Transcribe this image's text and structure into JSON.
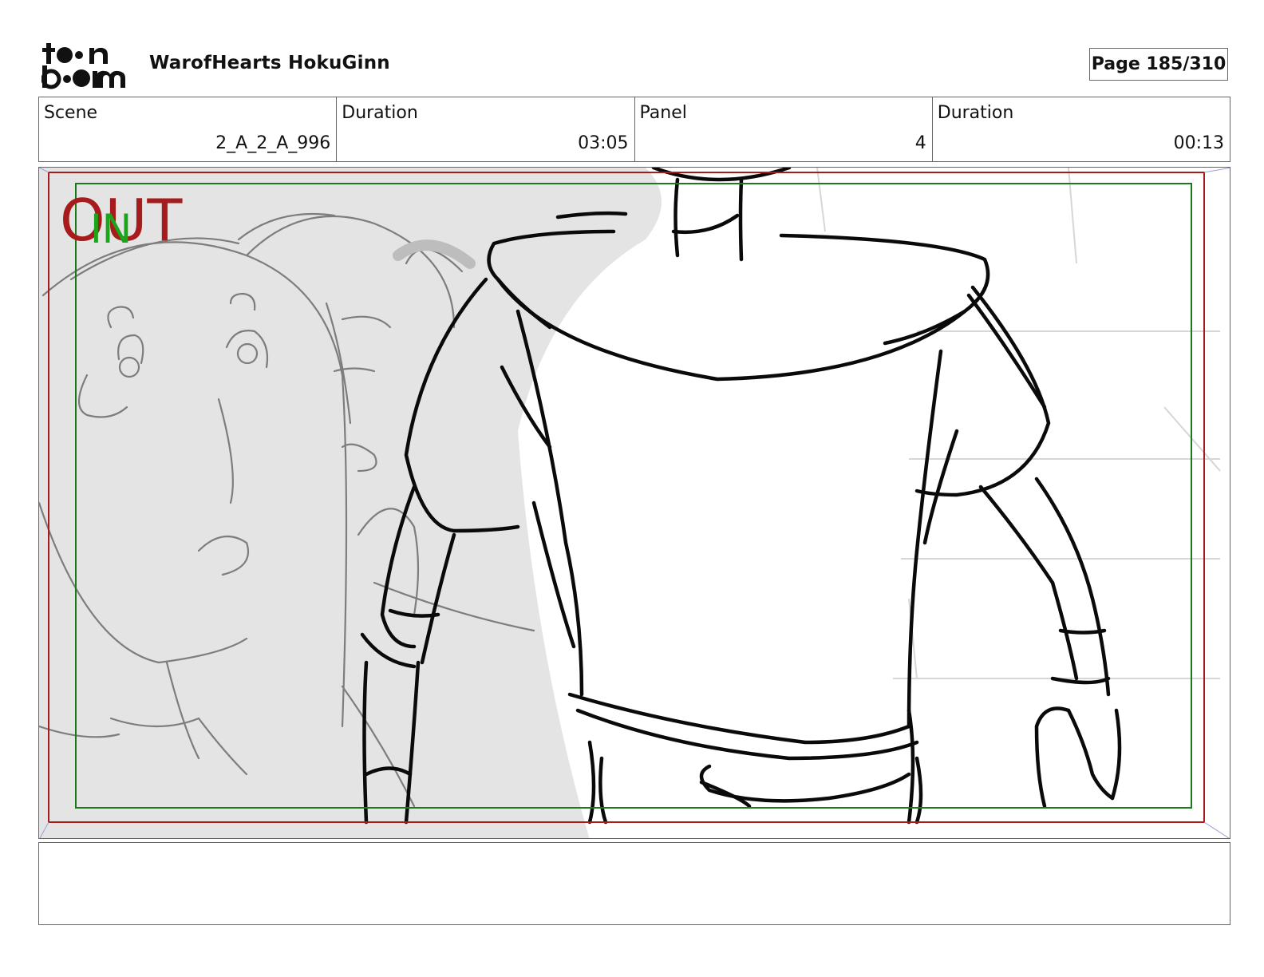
{
  "header": {
    "logo_text_top": "toon",
    "logo_text_bottom": "boom",
    "project_title": "WarofHearts HokuGinn",
    "page_label": "Page 185/310"
  },
  "info": {
    "scene_label": "Scene",
    "scene_value": "2_A_2_A_996",
    "scene_duration_label": "Duration",
    "scene_duration_value": "03:05",
    "panel_label": "Panel",
    "panel_value": "4",
    "panel_duration_label": "Duration",
    "panel_duration_value": "00:13"
  },
  "panel": {
    "out_label": "OUT",
    "in_label": "IN",
    "out_frame_color": "#a61c1c",
    "in_frame_color": "#1a7a1a"
  },
  "notes": {
    "text": ""
  }
}
